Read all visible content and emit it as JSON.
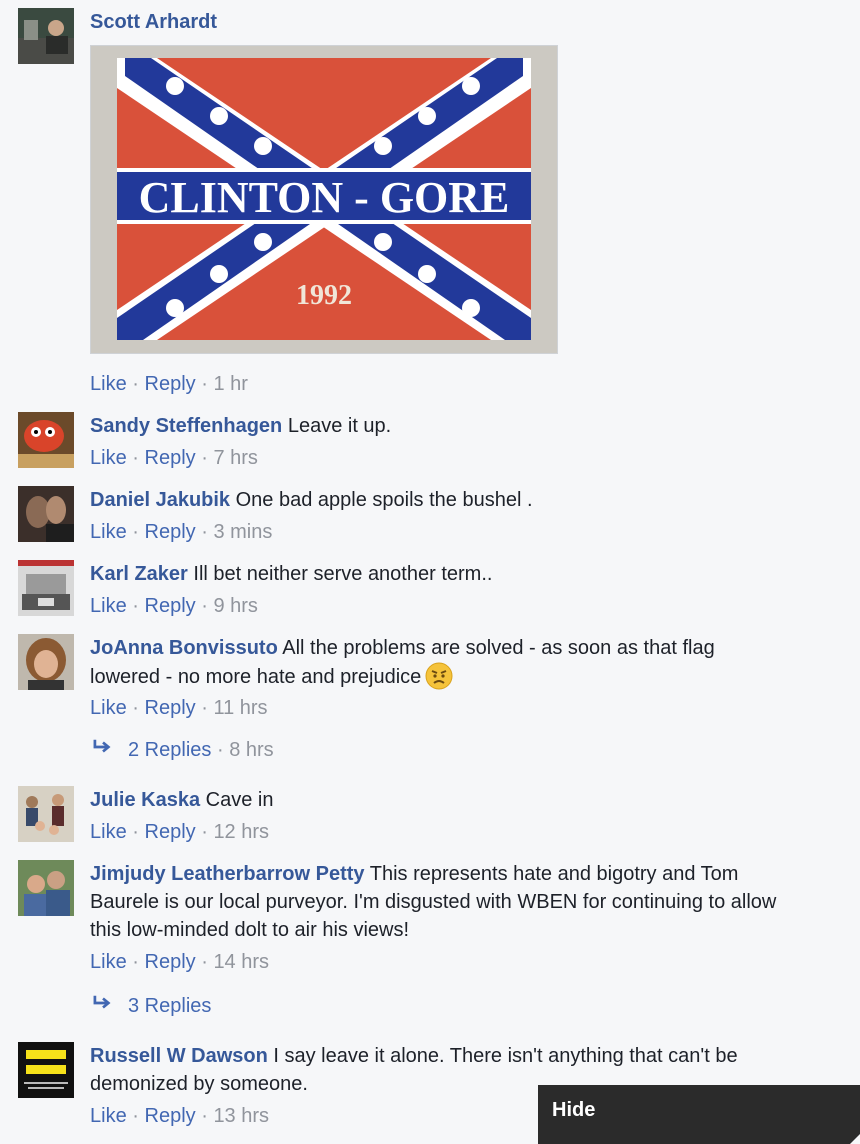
{
  "comments": [
    {
      "author": "Scott Arhardt",
      "text": "",
      "like": "Like",
      "reply": "Reply",
      "time": "1 hr",
      "sep": "·"
    },
    {
      "author": "Sandy Steffenhagen",
      "text": "Leave it up.",
      "like": "Like",
      "reply": "Reply",
      "time": "7 hrs",
      "sep": "·"
    },
    {
      "author": "Daniel Jakubik",
      "text": "One bad apple spoils the bushel .",
      "like": "Like",
      "reply": "Reply",
      "time": "3 mins",
      "sep": "·"
    },
    {
      "author": "Karl Zaker",
      "text": "Ill bet neither serve another term..",
      "like": "Like",
      "reply": "Reply",
      "time": "9 hrs",
      "sep": "·"
    },
    {
      "author": "JoAnna Bonvissuto",
      "text": "All the problems are solved - as soon as that flag",
      "text2": "lowered - no more hate and prejudice",
      "like": "Like",
      "reply": "Reply",
      "time": "11 hrs",
      "sep": "·",
      "replies": "2 Replies",
      "replies_time": "8 hrs"
    },
    {
      "author": "Julie Kaska",
      "text": "Cave in",
      "like": "Like",
      "reply": "Reply",
      "time": "12 hrs",
      "sep": "·"
    },
    {
      "author": "Jimjudy Leatherbarrow Petty",
      "text": "This represents hate and bigotry and Tom",
      "text2": "Baurele is our local purveyor. I'm disgusted with WBEN for continuing to allow",
      "text3": "this low-minded dolt to air his views!",
      "like": "Like",
      "reply": "Reply",
      "time": "14 hrs",
      "sep": "·",
      "replies": "3 Replies"
    },
    {
      "author": "Russell W Dawson",
      "text": "I say leave it alone. There isn't anything that can't be",
      "text2": "demonized by someone.",
      "like": "Like",
      "reply": "Reply",
      "time": "13 hrs",
      "sep": "·"
    }
  ],
  "image": {
    "headline": "CLINTON - GORE",
    "year": "1992"
  },
  "hide_label": "Hide",
  "colors": {
    "author": "#365899",
    "link": "#4267b2",
    "meta": "#90949c",
    "flag_red": "#d9513a",
    "flag_blue": "#22399a"
  }
}
